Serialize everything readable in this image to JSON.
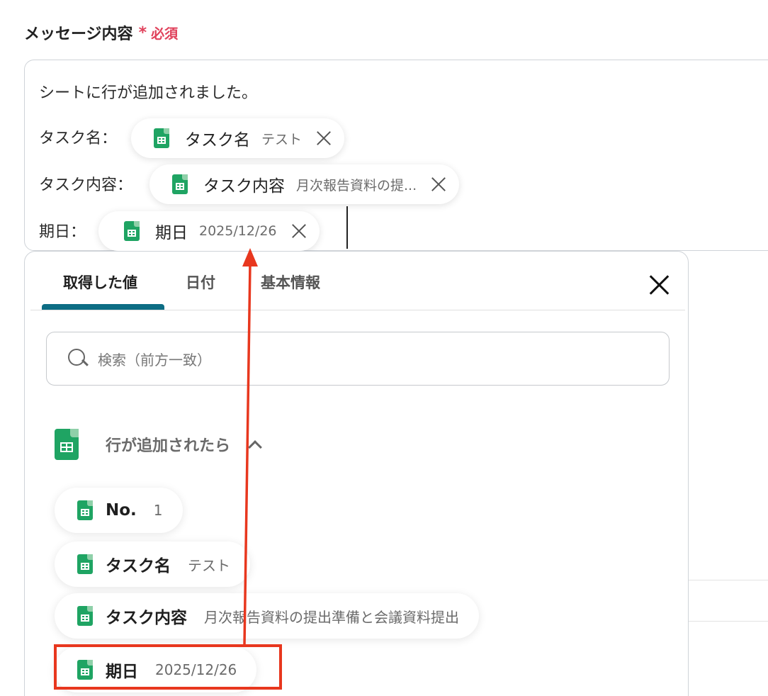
{
  "field": {
    "label": "メッセージ内容",
    "required_star": "*",
    "required_text": "必須"
  },
  "editor": {
    "line1": "シートに行が追加されました。",
    "lines": [
      {
        "label": "タスク名：",
        "chip_name": "タスク名",
        "chip_value": "テスト"
      },
      {
        "label": "タスク内容：",
        "chip_name": "タスク内容",
        "chip_value": "月次報告資料の提..."
      },
      {
        "label": "期日：",
        "chip_name": "期日",
        "chip_value": "2025/12/26"
      }
    ]
  },
  "panel": {
    "tabs": [
      "取得した値",
      "日付",
      "基本情報"
    ],
    "active_tab": "取得した値",
    "search_placeholder": "検索（前方一致）",
    "group_title": "行が追加されたら",
    "items": [
      {
        "name": "No.",
        "value": "1"
      },
      {
        "name": "タスク名",
        "value": "テスト"
      },
      {
        "name": "タスク内容",
        "value": "月次報告資料の提出準備と会議資料提出"
      },
      {
        "name": "期日",
        "value": "2025/12/26"
      }
    ]
  },
  "colors": {
    "required": "#e0415b",
    "accent_tab": "#0d6d84",
    "sheets_green": "#1fa463",
    "annotation_red": "#e8371e"
  },
  "icons": [
    "sheets-icon",
    "close-icon",
    "search-icon",
    "chevron-up-icon"
  ]
}
